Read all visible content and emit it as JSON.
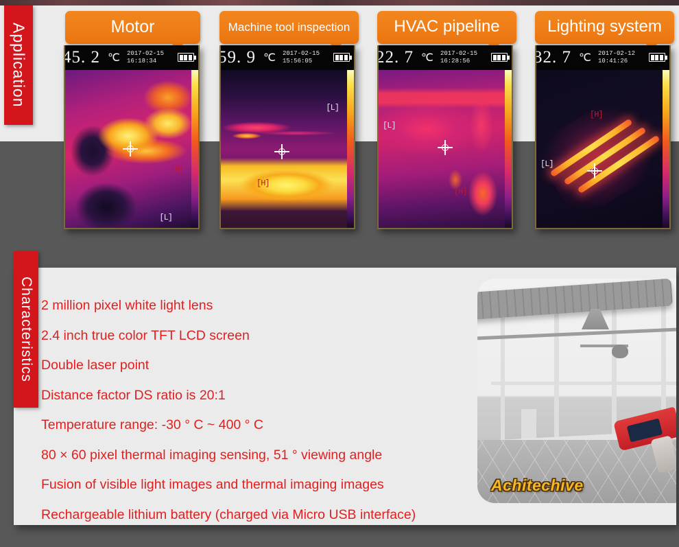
{
  "sections": {
    "application": {
      "tab_label": "Application",
      "cards": [
        {
          "badge": "Motor",
          "temperature": "45. 2",
          "unit": "℃",
          "date": "2017-02-15",
          "time": "16:18:34",
          "markers": {
            "high": "[H]",
            "low": "[L]"
          }
        },
        {
          "badge": "Machine tool inspection",
          "temperature": "59. 9",
          "unit": "℃",
          "date": "2017-02-15",
          "time": "15:56:05",
          "markers": {
            "high": "[H]",
            "low": "[L]"
          }
        },
        {
          "badge": "HVAC pipeline",
          "temperature": "22. 7",
          "unit": "℃",
          "date": "2017-02-15",
          "time": "16:28:56",
          "markers": {
            "high": "[H]",
            "low": "[L]"
          }
        },
        {
          "badge": "Lighting system",
          "temperature": "32. 7",
          "unit": "℃",
          "date": "2017-02-12",
          "time": "10:41:26",
          "markers": {
            "high": "[H]",
            "low": "[L]"
          }
        }
      ]
    },
    "characteristics": {
      "tab_label": "Characteristics",
      "items": [
        "2 million pixel white light lens",
        "2.4 inch true color TFT LCD screen",
        "Double laser point",
        "Distance factor DS ratio is 20:1",
        "Temperature range: -30 ° C ~ 400 ° C",
        "80 × 60 pixel thermal imaging sensing, 51 ° viewing angle",
        "Fusion of visible light images and thermal imaging images",
        "Rechargeable lithium battery (charged via Micro USB interface)"
      ],
      "photo_watermark": "Achitechive"
    }
  },
  "colors": {
    "tab_red": "#d3161c",
    "badge_orange": "#ef7e17",
    "text_red": "#e02020",
    "panel_light": "#ebebeb",
    "page_dark": "#585858",
    "watermark_gold": "#f5b820"
  }
}
